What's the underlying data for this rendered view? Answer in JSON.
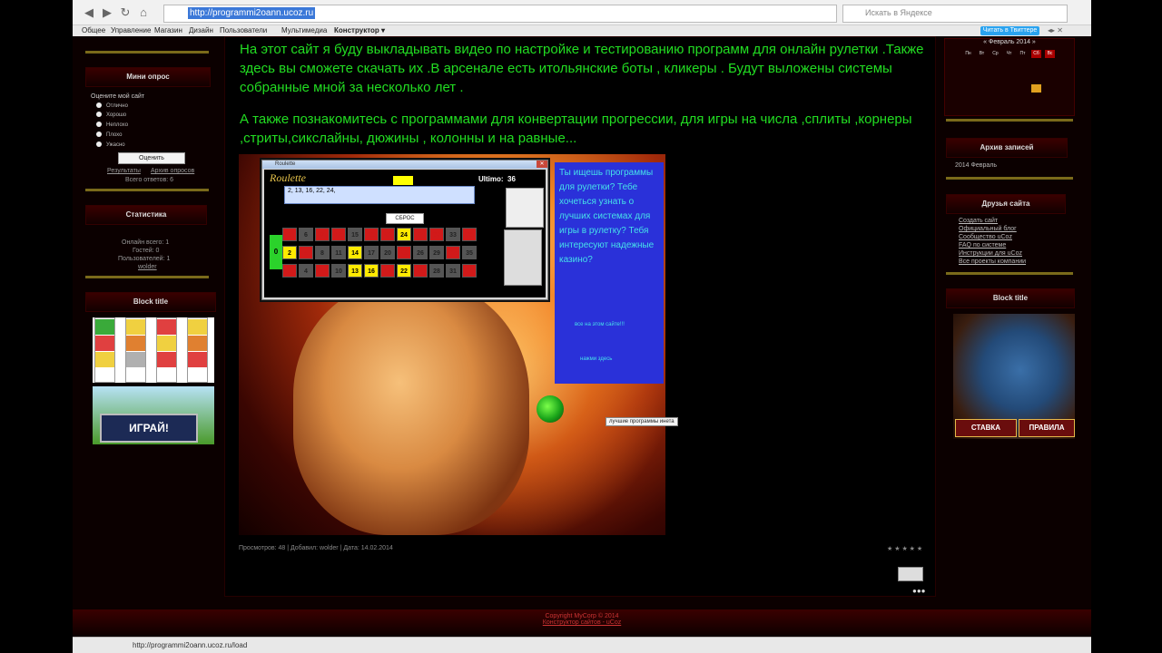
{
  "browser": {
    "nav": {
      "back": "◀",
      "forward": "▶",
      "reload": "↻",
      "home": "⌂"
    },
    "url": "http://programmi2oann.ucoz.ru",
    "search_placeholder": "Искать в Яндексе"
  },
  "menubar": {
    "items": [
      "Общее",
      "Управление",
      "Магазин",
      "Дизайн",
      "Пользователи",
      "Мультимедиа",
      "Конструктор ▾"
    ],
    "twitter": "Читать в Твиттере"
  },
  "left": {
    "poll": {
      "title": "Мини опрос",
      "question": "Оцените мой сайт",
      "options": [
        "Отлично",
        "Хорошо",
        "Неплохо",
        "Плохо",
        "Ужасно"
      ],
      "vote_button": "Оценить",
      "results_link": "Результаты",
      "archive_link": "Архив опросов",
      "total": "Всего ответов: 6"
    },
    "stats": {
      "title": "Статистика",
      "lines": [
        "Онлайн всего: 1",
        "Гостей: 0",
        "Пользователей: 1"
      ],
      "user": "wolder"
    },
    "block_title": "Block title",
    "ad_button": "ИГРАЙ!"
  },
  "main": {
    "paragraph1": "На этот сайт я буду выкладывать видео по настройке и тестированию программ для онлайн рулетки .Также здесь вы сможете скачать их .В арсенале есть итольянские боты , кликеры . Будут выложены системы собранные мной за несколько лет .",
    "paragraph2": "А также познакомитесь с программами для конвертации прогрессии, для игры на числа ,сплиты ,корнеры ,стриты,сикслайны, дюжины , колонны и на равные...",
    "roulette": {
      "title": "Roulette",
      "heading": "Roulette",
      "numbers": "2, 13, 16, 22, 24,",
      "ultimo_label": "Ultimo:",
      "ultimo_value": "36",
      "reset": "СБРОС",
      "grid_top": [
        "3",
        "6",
        "9",
        "12",
        "15",
        "18",
        "21",
        "24",
        "27",
        "30",
        "33",
        "36"
      ],
      "grid_mid": [
        "2",
        "5",
        "8",
        "11",
        "14",
        "17",
        "20",
        "23",
        "26",
        "29",
        "32",
        "35"
      ],
      "grid_bot": [
        "1",
        "4",
        "7",
        "10",
        "13",
        "16",
        "19",
        "22",
        "25",
        "28",
        "31",
        "34"
      ],
      "zero": "0"
    },
    "promo": {
      "text": "Ты ищешь программы для рулетки? Тебе хочеться узнать о лучших системах для игры в рулетку? Тебя интересуют надежные казино?",
      "link1": "все на этом сайте!!!",
      "link2": "нажми здесь"
    },
    "tooltip": "лучшие программы инета",
    "footer": "Просмотров: 48 | Добавил: wolder | Дата: 14.02.2014",
    "stars": "★ ★ ★ ★ ★"
  },
  "right": {
    "calendar_title": "« Февраль 2014 »",
    "calendar_days": [
      "Пн",
      "Вт",
      "Ср",
      "Чт",
      "Пт",
      "Сб",
      "Вс"
    ],
    "archive_title": "Архив записей",
    "archive_item": "2014 Февраль",
    "friends_title": "Друзья сайта",
    "friends": [
      "Создать сайт",
      "Официальный блог",
      "Сообщество uCoz",
      "FAQ по системе",
      "Инструкции для uCoz",
      "Все проекты компании"
    ],
    "block_title": "Block title",
    "ad_btn1": "СТАВКА",
    "ad_btn2": "ПРАВИЛА"
  },
  "copyright": "Copyright MyCorp © 2014",
  "copyright2": "Конструктор сайтов - uCoz",
  "status_url": "http://programmi2oann.ucoz.ru/load"
}
